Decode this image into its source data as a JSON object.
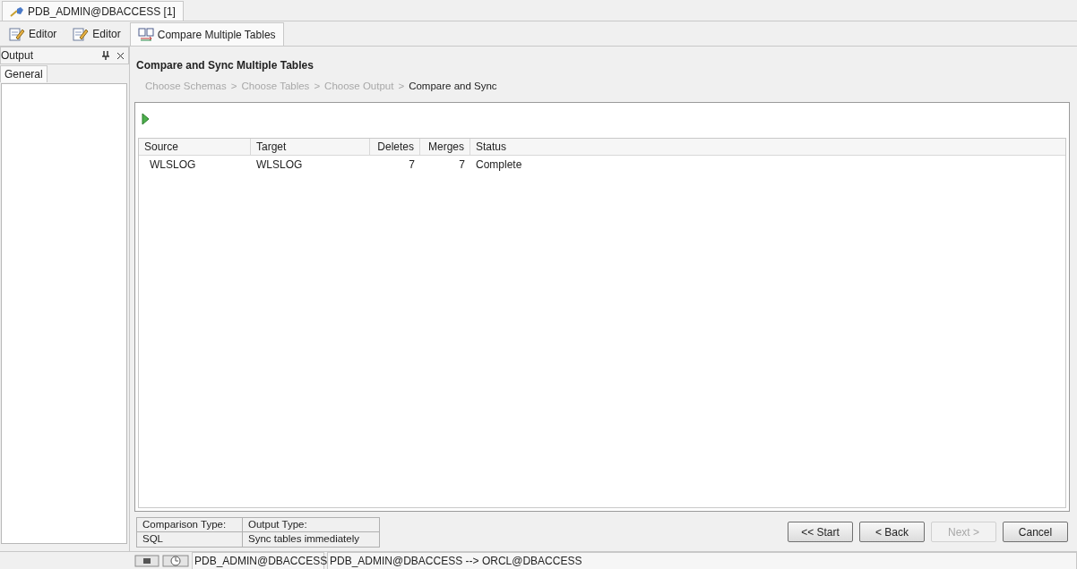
{
  "document_tab": {
    "title": "PDB_ADMIN@DBACCESS [1]"
  },
  "editor_tabs": [
    {
      "label": "Editor",
      "kind": "editor",
      "selected": false
    },
    {
      "label": "Editor",
      "kind": "editor",
      "selected": false
    },
    {
      "label": "Compare Multiple Tables",
      "kind": "compare",
      "selected": true
    }
  ],
  "output_panel": {
    "title": "Output",
    "tabs": [
      {
        "label": "General",
        "selected": true
      }
    ]
  },
  "wizard": {
    "title": "Compare and Sync Multiple Tables",
    "steps": [
      {
        "label": "Choose Schemas",
        "selected": false
      },
      {
        "label": "Choose Tables",
        "selected": false
      },
      {
        "label": "Choose Output",
        "selected": false
      },
      {
        "label": "Compare and Sync",
        "selected": true
      }
    ],
    "separator": ">",
    "table": {
      "columns": [
        "Source",
        "Target",
        "Deletes",
        "Merges",
        "Status"
      ],
      "rows": [
        [
          "WLSLOG",
          "WLSLOG",
          "7",
          "7",
          "Complete"
        ]
      ]
    },
    "summary": {
      "headers": [
        "Comparison Type:",
        "Output Type:"
      ],
      "values": [
        "SQL",
        "Sync tables immediately"
      ]
    },
    "buttons": [
      {
        "label": "<< Start",
        "disabled": false
      },
      {
        "label": "< Back",
        "disabled": false
      },
      {
        "label": "Next >",
        "disabled": true
      },
      {
        "label": "Cancel",
        "disabled": false
      }
    ]
  },
  "status_bar": {
    "connection": "PDB_ADMIN@DBACCESS",
    "sync": "PDB_ADMIN@DBACCESS --> ORCL@DBACCESS"
  }
}
